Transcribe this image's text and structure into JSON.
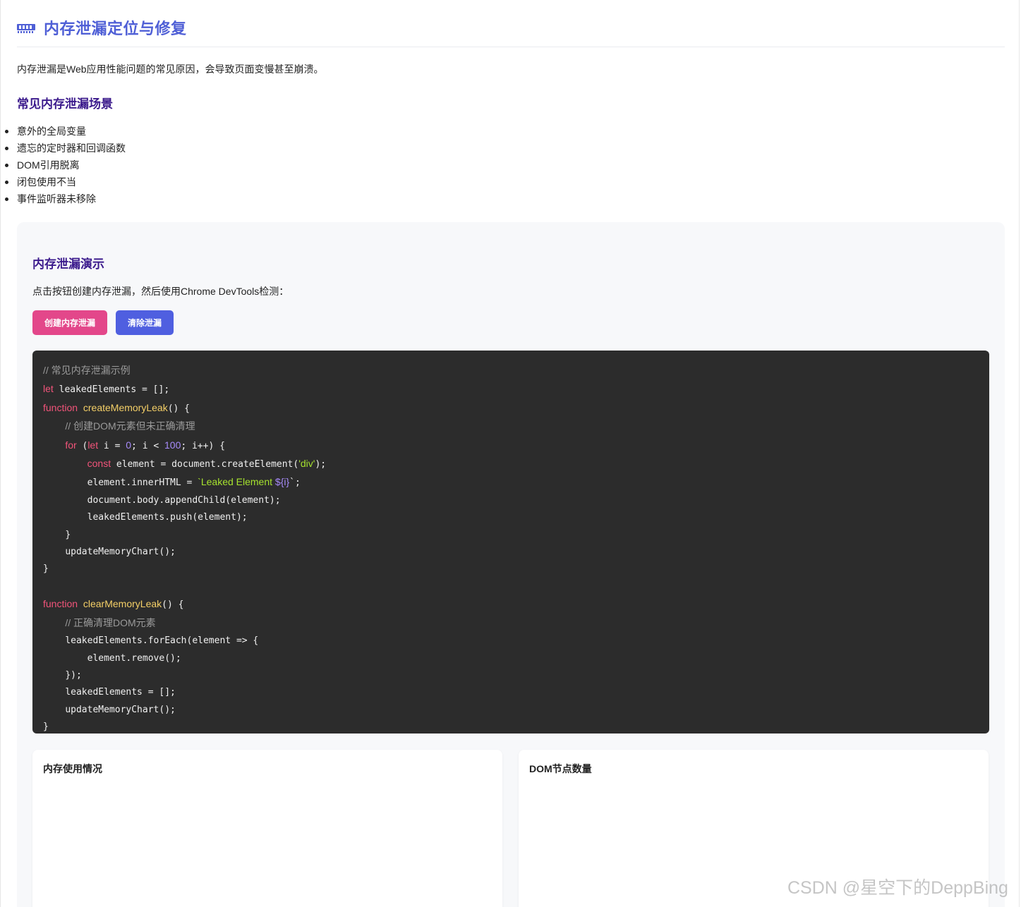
{
  "header": {
    "icon": "memory-chip-icon",
    "title": "内存泄漏定位与修复",
    "accent_color": "#4f5fd6"
  },
  "intro": "内存泄漏是Web应用性能问题的常见原因，会导致页面变慢甚至崩溃。",
  "scenarios": {
    "heading": "常见内存泄漏场景",
    "items": [
      "意外的全局变量",
      "遗忘的定时器和回调函数",
      "DOM引用脱离",
      "闭包使用不当",
      "事件监听器未移除"
    ]
  },
  "demo": {
    "title": "内存泄漏演示",
    "description": "点击按钮创建内存泄漏，然后使用Chrome DevTools检测：",
    "buttons": {
      "create": "创建内存泄漏",
      "clear": "清除泄漏"
    },
    "button_colors": {
      "create": "#e3478a",
      "clear": "#4f5fe0"
    },
    "code": {
      "l1": "// 常见内存泄漏示例",
      "l2_kw": "let",
      "l2_rest": " leakedElements = [];",
      "l3_kw": "function",
      "l3_fn": "createMemoryLeak",
      "l3_rest": "() {",
      "l4": "// 创建DOM元素但未正确清理",
      "l5_kw1": "for",
      "l5_a": " (",
      "l5_kw2": "let",
      "l5_b": " i = ",
      "l5_n1": "0",
      "l5_c": "; i < ",
      "l5_n2": "100",
      "l5_d": "; i++) {",
      "l6_kw": "const",
      "l6_a": " element = document.createElement(",
      "l6_str": "'div'",
      "l6_b": ");",
      "l7_a": "element.innerHTML = ",
      "l7_str": "`Leaked Element ",
      "l7_var": "${i}",
      "l7_b": "`;",
      "l8": "document.body.appendChild(element);",
      "l9": "leakedElements.push(element);",
      "l10": "}",
      "l11": "updateMemoryChart();",
      "l12": "}",
      "l14_kw": "function",
      "l14_fn": "clearMemoryLeak",
      "l14_rest": "() {",
      "l15": "// 正确清理DOM元素",
      "l16": "leakedElements.forEach(element => {",
      "l17": "element.remove();",
      "l18": "});",
      "l19": "leakedElements = [];",
      "l20": "updateMemoryChart();",
      "l21": "}"
    }
  },
  "charts": {
    "memory": {
      "title": "内存使用情况"
    },
    "dom": {
      "title": "DOM节点数量"
    }
  },
  "watermark": "CSDN @星空下的DeppBing"
}
